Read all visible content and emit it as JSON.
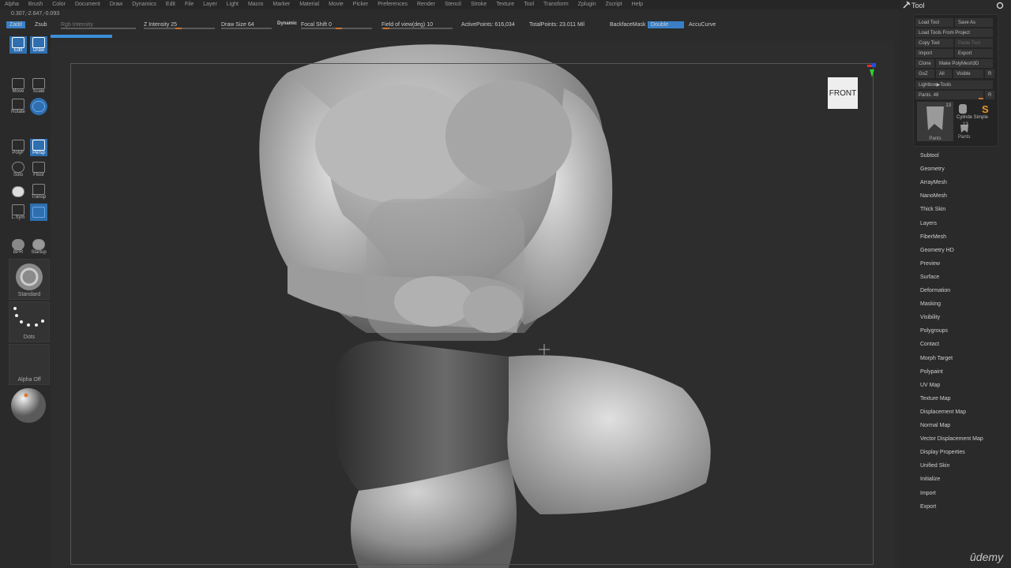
{
  "menu": [
    "Alpha",
    "Brush",
    "Color",
    "Document",
    "Draw",
    "Dynamics",
    "Edit",
    "File",
    "Layer",
    "Light",
    "Macro",
    "Marker",
    "Material",
    "Movie",
    "Picker",
    "Preferences",
    "Render",
    "Stencil",
    "Stroke",
    "Texture",
    "Tool",
    "Transform",
    "Zplugin",
    "Zscript",
    "Help"
  ],
  "coords": "0.307,-2.647,-0.093",
  "topbar": {
    "zadd": "Zadd",
    "zsub": "Zsub",
    "rgb_intensity": "Rgb Intensity",
    "z_intensity": "Z Intensity 25",
    "draw_size": "Draw Size 64",
    "dynamic": "Dynamic",
    "focal_shift": "Focal Shift 0",
    "field_of_view": "Field of view(deg) 10",
    "active_points": "ActivePoints: 616,034",
    "total_points": "TotalPoints: 23.011 Mil",
    "backface_mask": "BackfaceMask",
    "double": "Double",
    "accu_curve": "AccuCurve"
  },
  "left_tools": {
    "edit": "Edit",
    "draw": "Draw",
    "move": "Move",
    "scale": "Scale",
    "rotate": "Rotate",
    "polyf": "PolyF",
    "persp": "Persp",
    "solo": "Solo",
    "floor": "Floor",
    "transp": "Transp",
    "lsym": "L.Sym",
    "bpr": "BPR",
    "startup": "Startup",
    "brush": "Standard",
    "stroke": "Dots",
    "alpha": "Alpha Off"
  },
  "viewport": {
    "view_label": "FRONT"
  },
  "tool_panel": {
    "title": "Tool",
    "load_tool": "Load Tool",
    "save_as": "Save As",
    "load_from_project": "Load Tools From Project",
    "copy_tool": "Copy Tool",
    "paste_tool": "Paste Tool",
    "import": "Import",
    "export": "Export",
    "clone": "Clone",
    "make_polymesh": "Make PolyMesh3D",
    "goz": "GoZ",
    "all": "All",
    "visible": "Visible",
    "r": "R",
    "lightbox_tools": "Lightbox▶Tools",
    "pants_slider": "Pants. 48",
    "thumb_count_1": "13",
    "thumb_count_2": "13",
    "thumb_label_1": "Pants",
    "thumb_label_2": "Cylinde Simple",
    "thumb_label_3": "Pants",
    "items": [
      "Subtool",
      "Geometry",
      "ArrayMesh",
      "NanoMesh",
      "Thick Skin",
      "Layers",
      "FiberMesh",
      "Geometry HD",
      "Preview",
      "Surface",
      "Deformation",
      "Masking",
      "Visibility",
      "Polygroups",
      "Contact",
      "Morph Target",
      "Polypaint",
      "UV Map",
      "Texture Map",
      "Displacement Map",
      "Normal Map",
      "Vector Displacement Map",
      "Display Properties",
      "Unified Skin",
      "Initialize",
      "Import",
      "Export"
    ]
  },
  "watermark": "ûdemy"
}
